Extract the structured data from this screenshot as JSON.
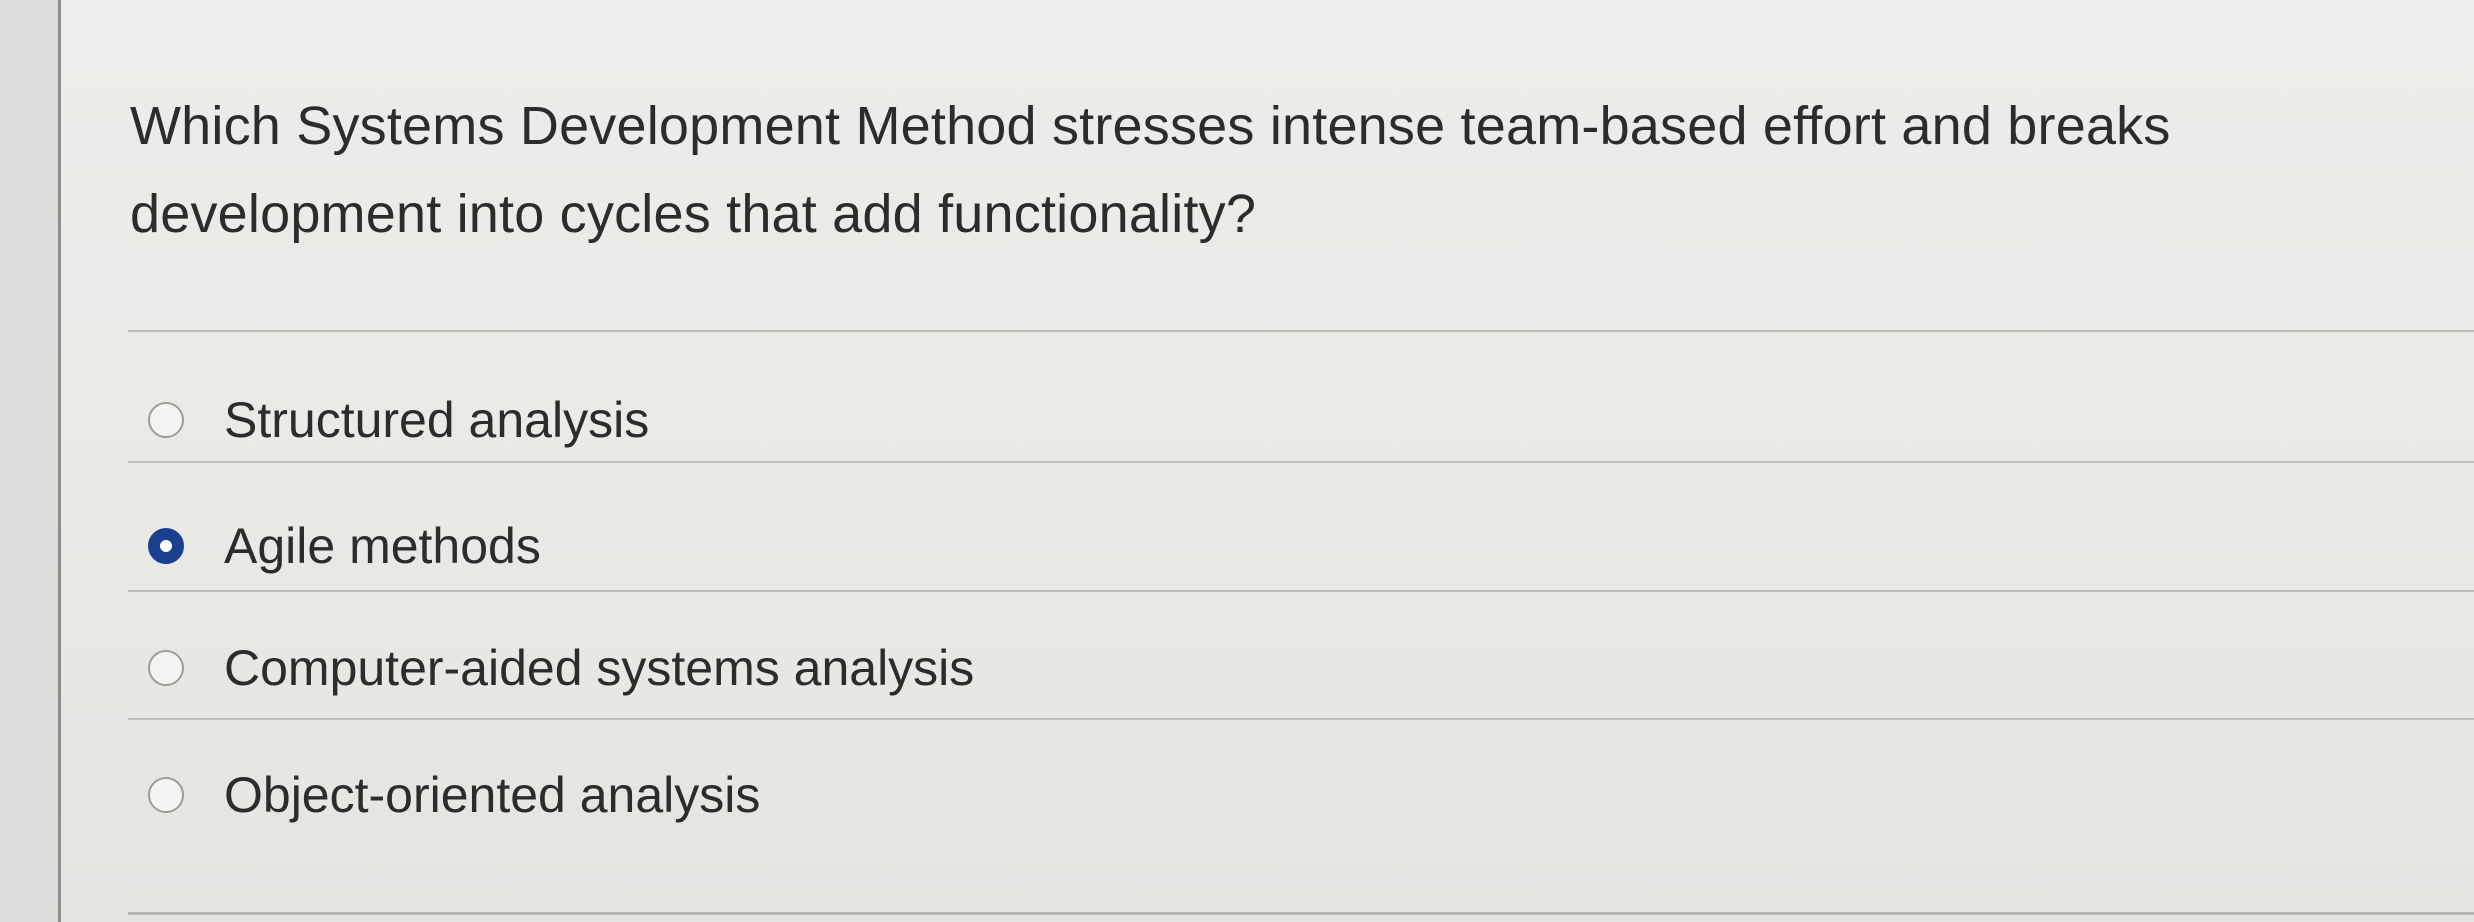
{
  "question": {
    "text": "Which Systems Development Method stresses intense team-based effort and breaks development into cycles that add functionality?"
  },
  "options": [
    {
      "label": "Structured analysis",
      "selected": false
    },
    {
      "label": "Agile methods",
      "selected": true
    },
    {
      "label": "Computer-aided systems analysis",
      "selected": false
    },
    {
      "label": "Object-oriented analysis",
      "selected": false
    }
  ],
  "colors": {
    "selected_radio": "#1b3f8f",
    "text": "#2c2c2c",
    "background": "#e9e9e7"
  }
}
